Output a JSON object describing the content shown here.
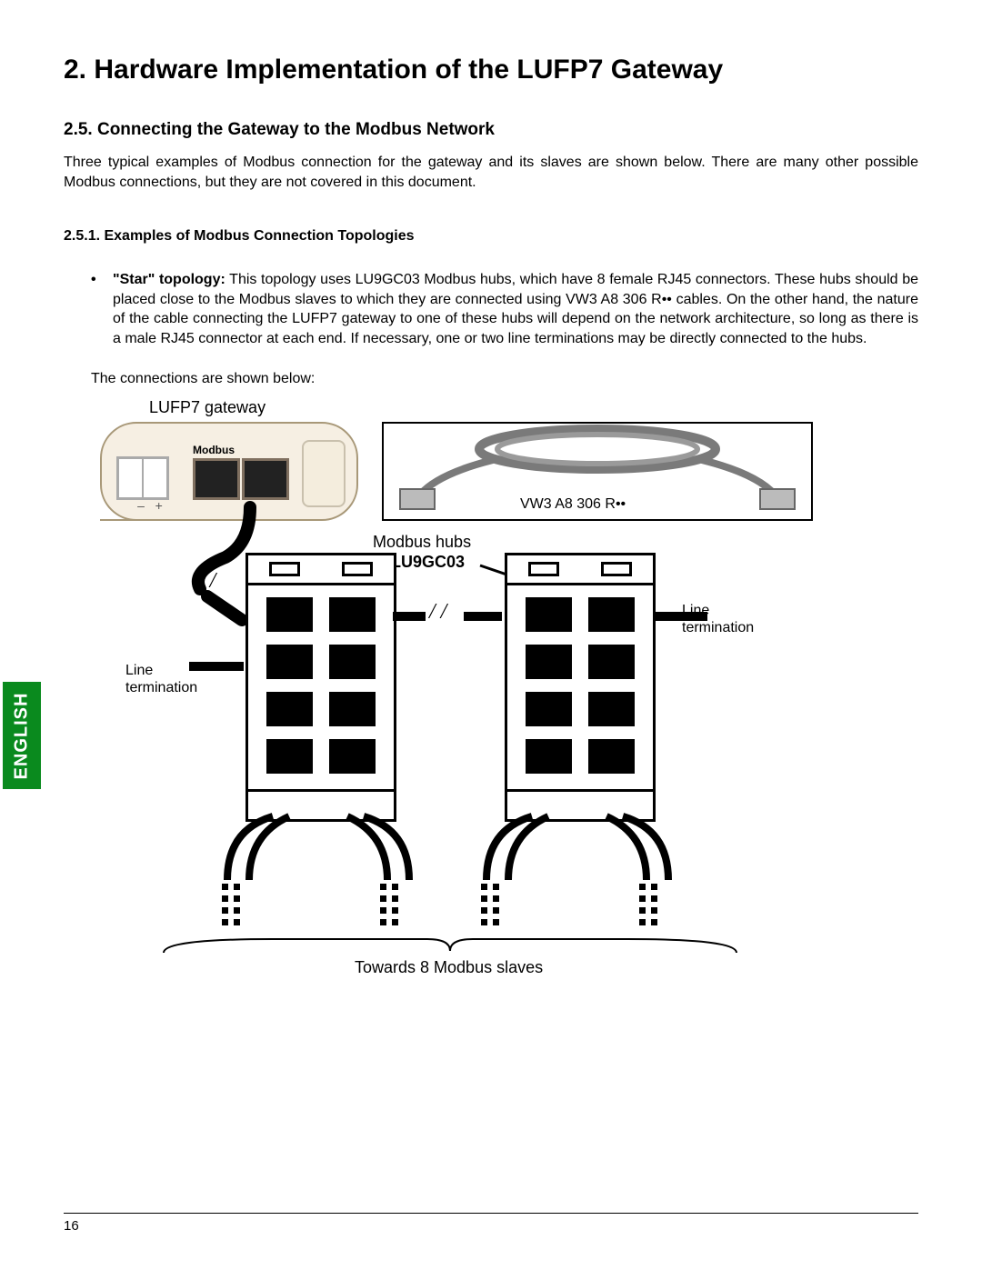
{
  "title": "2. Hardware Implementation of the LUFP7 Gateway",
  "section": "2.5. Connecting the Gateway to the Modbus Network",
  "intro": "Three typical examples of Modbus connection for the gateway and its slaves are shown below. There are many other possible Modbus connections, but they are not covered in this document.",
  "subsection": "2.5.1. Examples of Modbus Connection Topologies",
  "bullet_lead_bold": "\"Star\" topology:",
  "bullet_text": " This topology uses LU9GC03 Modbus hubs, which have 8 female RJ45 connectors. These hubs should be placed close to the Modbus slaves to which they are connected using VW3 A8 306 R•• cables. On the other hand, the nature of the cable connecting the LUFP7 gateway to one of these hubs will depend on the network architecture, so long as there is a male RJ45 connector at each end. If necessary, one or two line terminations may be directly connected to the hubs.",
  "connections_line": "The connections are shown below:",
  "diagram": {
    "gateway_label": "LUFP7 gateway",
    "gateway_port_label": "Modbus",
    "cable_label": "VW3 A8 306 R••",
    "hubs_label": "Modbus hubs",
    "hubs_model": "LU9GC03",
    "line_term_left": "Line\ntermination",
    "line_term_right": "Line\ntermination",
    "slaves_label": "Towards 8 Modbus slaves"
  },
  "language_tab": "ENGLISH",
  "page_number": "16"
}
